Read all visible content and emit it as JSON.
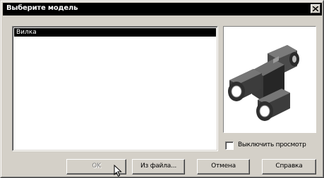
{
  "window": {
    "title": "Выберите модель",
    "close_icon": "close-icon"
  },
  "model_list": {
    "items": [
      {
        "label": "Вилка",
        "selected": true
      }
    ]
  },
  "preview": {
    "icon": "fork-model-3d-preview"
  },
  "options": {
    "disable_preview_label": "Выключить просмотр",
    "disable_preview_checked": false
  },
  "buttons": {
    "ok_label": "OK",
    "ok_enabled": false,
    "from_file_label": "Из файла...",
    "cancel_label": "Отмена",
    "help_label": "Справка"
  },
  "colors": {
    "face": "#d4d0c8",
    "titlebar": "#000000",
    "selection": "#000000",
    "model": "#3a3a3a"
  }
}
